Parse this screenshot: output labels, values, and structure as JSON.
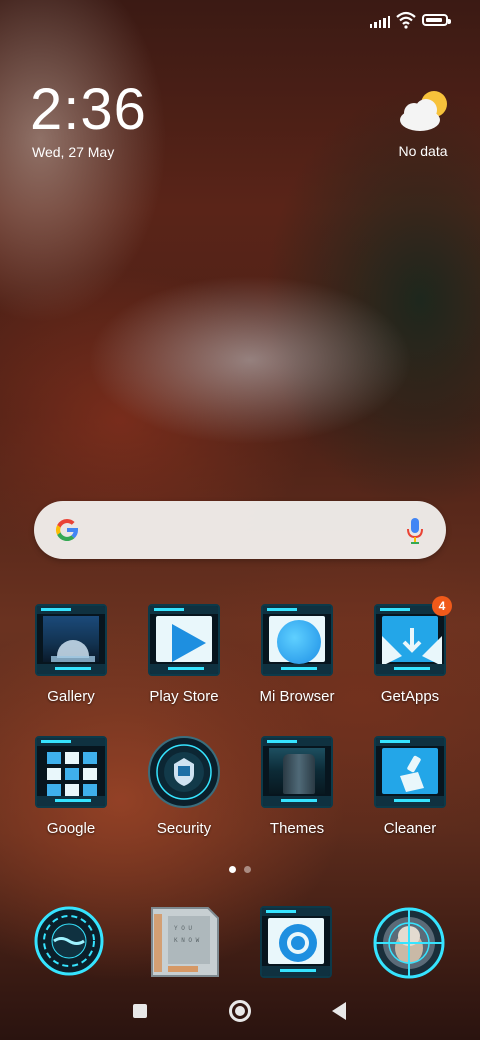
{
  "status_bar": {
    "signal_icon": "signal-bars-icon",
    "wifi_icon": "wifi-icon",
    "battery_icon": "battery-icon",
    "battery_level": 0.9
  },
  "clock": {
    "time": "2:36",
    "date": "Wed, 27 May"
  },
  "weather": {
    "icon": "partly-cloudy-icon",
    "text": "No data"
  },
  "search_bar": {
    "logo_icon": "google-g-icon",
    "mic_icon": "microphone-icon"
  },
  "apps": [
    {
      "label": "Gallery"
    },
    {
      "label": "Play Store"
    },
    {
      "label": "Mi Browser"
    },
    {
      "label": "GetApps",
      "badge": "4"
    },
    {
      "label": "Google"
    },
    {
      "label": "Security"
    },
    {
      "label": "Themes"
    },
    {
      "label": "Cleaner"
    }
  ],
  "dock": [
    {
      "icon": "hud-ring-icon"
    },
    {
      "icon": "hud-panel-icon"
    },
    {
      "icon": "chromium-icon"
    },
    {
      "icon": "crosshair-portrait-icon"
    }
  ],
  "page_indicator": {
    "pages": 2,
    "current": 1
  },
  "nav_bar": {
    "recents_icon": "square-recents-icon",
    "home_icon": "circle-home-icon",
    "back_icon": "triangle-back-icon"
  },
  "colors": {
    "accent_cyan": "#36e4ff",
    "badge_orange": "#f05a1a",
    "play_blue": "#1e8fe0"
  }
}
